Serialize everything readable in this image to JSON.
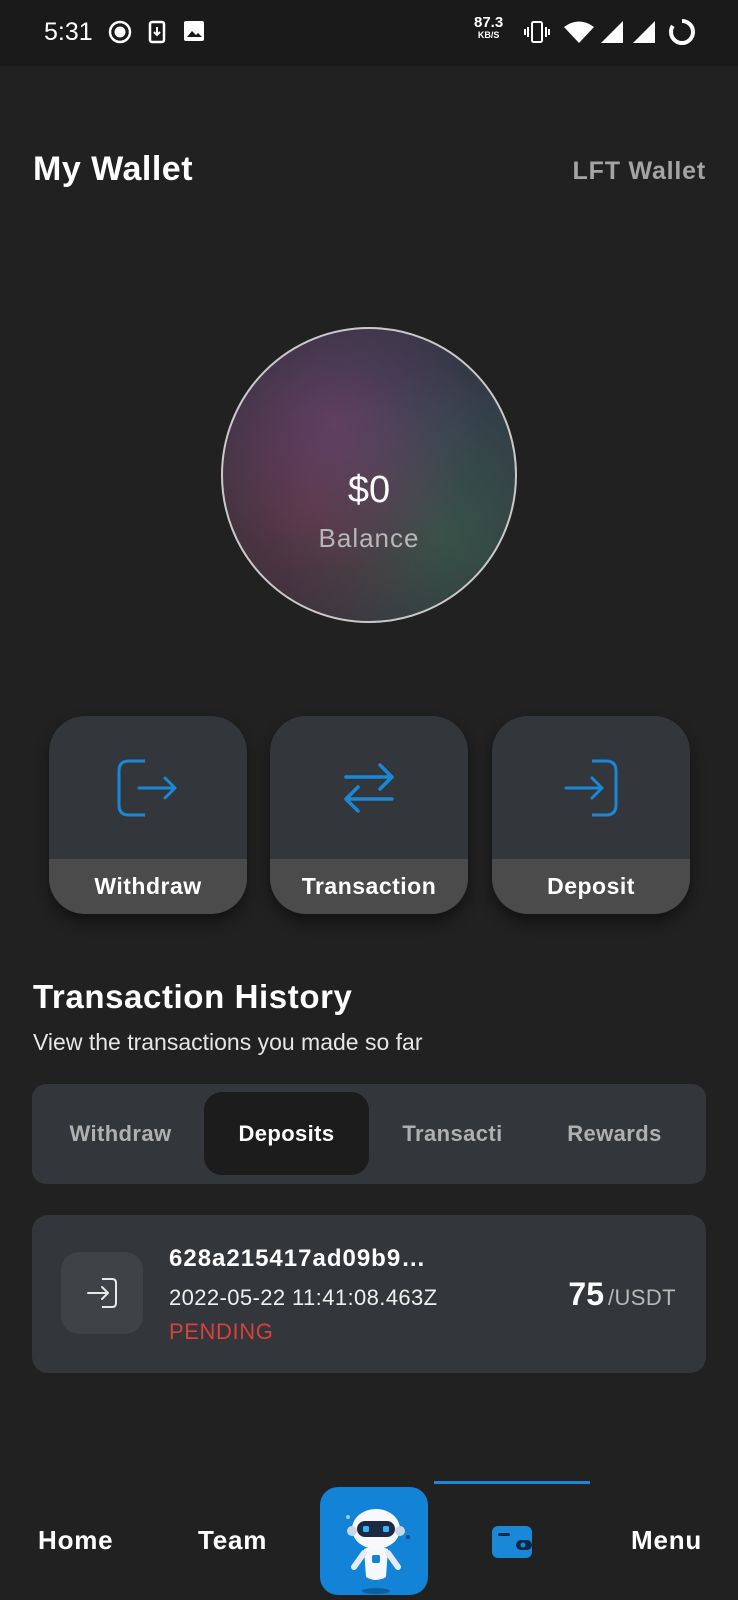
{
  "status_bar": {
    "time": "5:31",
    "net_speed_value": "87.3",
    "net_speed_unit": "KB/S",
    "icons": [
      "record-icon",
      "download-icon",
      "image-icon",
      "vibrate-icon",
      "wifi-icon",
      "signal-icon",
      "signal-icon",
      "battery-ring-icon"
    ]
  },
  "header": {
    "title": "My Wallet",
    "wallet_link": "LFT Wallet"
  },
  "balance": {
    "value": "$0",
    "label": "Balance"
  },
  "actions": [
    {
      "label": "Withdraw",
      "icon": "withdraw-icon"
    },
    {
      "label": "Transaction",
      "icon": "swap-icon"
    },
    {
      "label": "Deposit",
      "icon": "deposit-icon"
    }
  ],
  "history": {
    "title": "Transaction History",
    "subtitle": "View the transactions you made so far",
    "tabs": [
      {
        "label": "Withdraw",
        "active": false
      },
      {
        "label": "Deposits",
        "active": true
      },
      {
        "label": "Transacti",
        "active": false
      },
      {
        "label": "Rewards",
        "active": false
      }
    ],
    "transactions": [
      {
        "id": "628a215417ad09b9…",
        "date": "2022-05-22 11:41:08.463Z",
        "status": "PENDING",
        "amount": "75",
        "currency": "/USDT"
      }
    ]
  },
  "bottom_nav": {
    "items": [
      {
        "label": "Home"
      },
      {
        "label": "Team"
      },
      {
        "label": "",
        "icon": "robot-icon"
      },
      {
        "label": "",
        "icon": "wallet-icon",
        "active": true
      },
      {
        "label": "Menu"
      }
    ]
  },
  "colors": {
    "background": "#212121",
    "card": "#33363a",
    "accent": "#1283d6",
    "pending": "#d9423a"
  }
}
